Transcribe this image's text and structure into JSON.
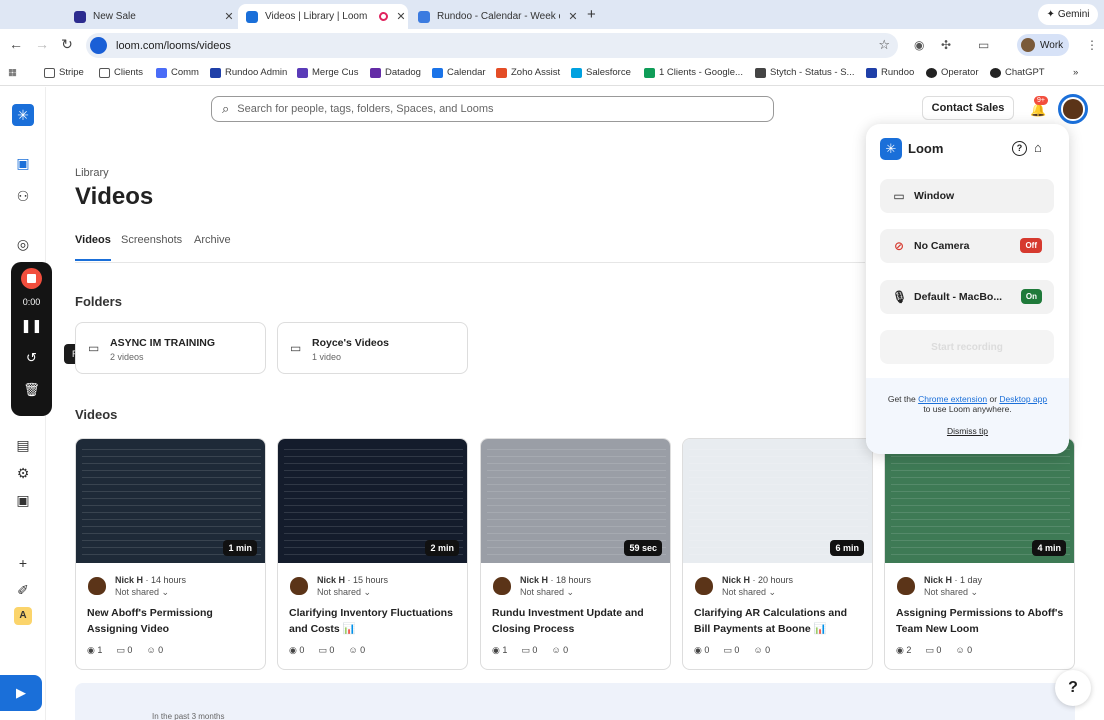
{
  "browser": {
    "tabs": [
      {
        "title": "New Sale",
        "favicon_color": "#2c2c8f"
      },
      {
        "title": "Videos | Library | Loom",
        "favicon_color": "#1a6fd9"
      },
      {
        "title": "Rundoo - Calendar - Week of",
        "favicon_color": "#3b7be0"
      }
    ],
    "new_tab": "+",
    "gemini_label": "Gemini",
    "url": "loom.com/looms/videos",
    "profile_label": "Work"
  },
  "bookmarks": [
    {
      "label": "Stripe",
      "color": "#635bff"
    },
    {
      "label": "Clients",
      "color": "#888888"
    },
    {
      "label": "Comm",
      "color": "#4a6cf7"
    },
    {
      "label": "Rundoo Admin",
      "color": "#1f3fa8"
    },
    {
      "label": "Merge Cus",
      "color": "#5a3bb8"
    },
    {
      "label": "Datadog",
      "color": "#632ca6"
    },
    {
      "label": "Calendar",
      "color": "#1a73e8"
    },
    {
      "label": "Zoho Assist",
      "color": "#e44d26"
    },
    {
      "label": "Salesforce",
      "color": "#00a1e0"
    },
    {
      "label": "1 Clients - Google...",
      "color": "#0f9d58"
    },
    {
      "label": "Stytch - Status - S...",
      "color": "#444444"
    },
    {
      "label": "Rundoo",
      "color": "#1f3fa8"
    },
    {
      "label": "Operator",
      "color": "#222222"
    },
    {
      "label": "ChatGPT",
      "color": "#222222"
    }
  ],
  "recorder": {
    "time": "0:00",
    "tooltip": "Recent"
  },
  "header": {
    "search_placeholder": "Search for people, tags, folders, Spaces, and Looms",
    "contact_sales": "Contact Sales",
    "notification_badge": "9+"
  },
  "library": {
    "breadcrumb": "Library",
    "title": "Videos",
    "tabs": [
      "Videos",
      "Screenshots",
      "Archive"
    ],
    "folders_heading": "Folders",
    "folders": [
      {
        "name": "ASYNC IM TRAINING",
        "count": "2 videos"
      },
      {
        "name": "Royce's Videos",
        "count": "1 video"
      }
    ],
    "videos_heading": "Videos",
    "videos": [
      {
        "duration": "1 min",
        "author": "Nick H",
        "time": "14 hours",
        "sharing": "Not shared",
        "title": "New Aboff's Permissiong Assigning Video",
        "views": "1",
        "comments": "0",
        "reactions": "0",
        "thumb_bg": "#1e2a38"
      },
      {
        "duration": "2 min",
        "author": "Nick H",
        "time": "15 hours",
        "sharing": "Not shared",
        "title": "Clarifying Inventory Fluctuations and Costs 📊",
        "views": "0",
        "comments": "0",
        "reactions": "0",
        "thumb_bg": "#141c2c"
      },
      {
        "duration": "59 sec",
        "author": "Nick H",
        "time": "18 hours",
        "sharing": "Not shared",
        "title": "Rundu Investment Update and Closing Process",
        "views": "1",
        "comments": "0",
        "reactions": "0",
        "thumb_bg": "#9a9ea6"
      },
      {
        "duration": "6 min",
        "author": "Nick H",
        "time": "20 hours",
        "sharing": "Not shared",
        "title": "Clarifying AR Calculations and Bill Payments at Boone 📊",
        "views": "0",
        "comments": "0",
        "reactions": "0",
        "thumb_bg": "#e8ecf0"
      },
      {
        "duration": "4 min",
        "author": "Nick H",
        "time": "1 day",
        "sharing": "Not shared",
        "title": "Assigning Permissions to Aboff's Team New Loom",
        "views": "2",
        "comments": "0",
        "reactions": "0",
        "thumb_bg": "#3e7a55"
      }
    ],
    "bottom_text": "In the past 3 months"
  },
  "loom_popup": {
    "brand": "Loom",
    "window_label": "Window",
    "camera_label": "No Camera",
    "camera_state": "Off",
    "mic_label": "Default - MacBo...",
    "mic_state": "On",
    "start_label": "Start recording",
    "footer_prefix": "Get the",
    "chrome_link": "Chrome extension",
    "footer_or": "or",
    "desktop_link": "Desktop app",
    "footer_suffix": "to use Loom anywhere.",
    "dismiss": "Dismiss tip"
  },
  "help_label": "?",
  "colors": {
    "accent": "#1a6fd9",
    "record_red": "#f24e3d",
    "on_green": "#1f7a3a",
    "off_red": "#d63a2f"
  }
}
